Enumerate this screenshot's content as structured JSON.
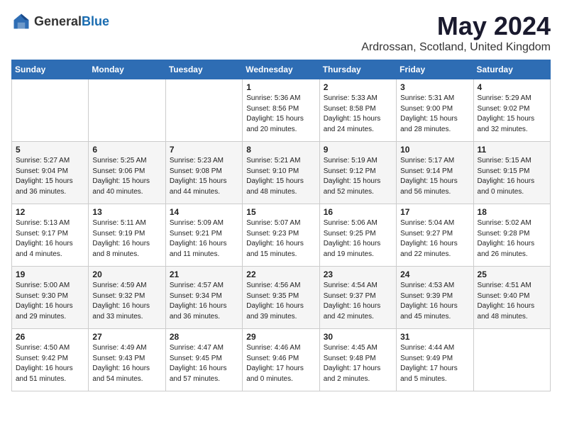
{
  "logo": {
    "text_general": "General",
    "text_blue": "Blue"
  },
  "title": "May 2024",
  "subtitle": "Ardrossan, Scotland, United Kingdom",
  "days_of_week": [
    "Sunday",
    "Monday",
    "Tuesday",
    "Wednesday",
    "Thursday",
    "Friday",
    "Saturday"
  ],
  "weeks": [
    [
      {
        "day": "",
        "sunrise": "",
        "sunset": "",
        "daylight": ""
      },
      {
        "day": "",
        "sunrise": "",
        "sunset": "",
        "daylight": ""
      },
      {
        "day": "",
        "sunrise": "",
        "sunset": "",
        "daylight": ""
      },
      {
        "day": "1",
        "sunrise": "Sunrise: 5:36 AM",
        "sunset": "Sunset: 8:56 PM",
        "daylight": "Daylight: 15 hours and 20 minutes."
      },
      {
        "day": "2",
        "sunrise": "Sunrise: 5:33 AM",
        "sunset": "Sunset: 8:58 PM",
        "daylight": "Daylight: 15 hours and 24 minutes."
      },
      {
        "day": "3",
        "sunrise": "Sunrise: 5:31 AM",
        "sunset": "Sunset: 9:00 PM",
        "daylight": "Daylight: 15 hours and 28 minutes."
      },
      {
        "day": "4",
        "sunrise": "Sunrise: 5:29 AM",
        "sunset": "Sunset: 9:02 PM",
        "daylight": "Daylight: 15 hours and 32 minutes."
      }
    ],
    [
      {
        "day": "5",
        "sunrise": "Sunrise: 5:27 AM",
        "sunset": "Sunset: 9:04 PM",
        "daylight": "Daylight: 15 hours and 36 minutes."
      },
      {
        "day": "6",
        "sunrise": "Sunrise: 5:25 AM",
        "sunset": "Sunset: 9:06 PM",
        "daylight": "Daylight: 15 hours and 40 minutes."
      },
      {
        "day": "7",
        "sunrise": "Sunrise: 5:23 AM",
        "sunset": "Sunset: 9:08 PM",
        "daylight": "Daylight: 15 hours and 44 minutes."
      },
      {
        "day": "8",
        "sunrise": "Sunrise: 5:21 AM",
        "sunset": "Sunset: 9:10 PM",
        "daylight": "Daylight: 15 hours and 48 minutes."
      },
      {
        "day": "9",
        "sunrise": "Sunrise: 5:19 AM",
        "sunset": "Sunset: 9:12 PM",
        "daylight": "Daylight: 15 hours and 52 minutes."
      },
      {
        "day": "10",
        "sunrise": "Sunrise: 5:17 AM",
        "sunset": "Sunset: 9:14 PM",
        "daylight": "Daylight: 15 hours and 56 minutes."
      },
      {
        "day": "11",
        "sunrise": "Sunrise: 5:15 AM",
        "sunset": "Sunset: 9:15 PM",
        "daylight": "Daylight: 16 hours and 0 minutes."
      }
    ],
    [
      {
        "day": "12",
        "sunrise": "Sunrise: 5:13 AM",
        "sunset": "Sunset: 9:17 PM",
        "daylight": "Daylight: 16 hours and 4 minutes."
      },
      {
        "day": "13",
        "sunrise": "Sunrise: 5:11 AM",
        "sunset": "Sunset: 9:19 PM",
        "daylight": "Daylight: 16 hours and 8 minutes."
      },
      {
        "day": "14",
        "sunrise": "Sunrise: 5:09 AM",
        "sunset": "Sunset: 9:21 PM",
        "daylight": "Daylight: 16 hours and 11 minutes."
      },
      {
        "day": "15",
        "sunrise": "Sunrise: 5:07 AM",
        "sunset": "Sunset: 9:23 PM",
        "daylight": "Daylight: 16 hours and 15 minutes."
      },
      {
        "day": "16",
        "sunrise": "Sunrise: 5:06 AM",
        "sunset": "Sunset: 9:25 PM",
        "daylight": "Daylight: 16 hours and 19 minutes."
      },
      {
        "day": "17",
        "sunrise": "Sunrise: 5:04 AM",
        "sunset": "Sunset: 9:27 PM",
        "daylight": "Daylight: 16 hours and 22 minutes."
      },
      {
        "day": "18",
        "sunrise": "Sunrise: 5:02 AM",
        "sunset": "Sunset: 9:28 PM",
        "daylight": "Daylight: 16 hours and 26 minutes."
      }
    ],
    [
      {
        "day": "19",
        "sunrise": "Sunrise: 5:00 AM",
        "sunset": "Sunset: 9:30 PM",
        "daylight": "Daylight: 16 hours and 29 minutes."
      },
      {
        "day": "20",
        "sunrise": "Sunrise: 4:59 AM",
        "sunset": "Sunset: 9:32 PM",
        "daylight": "Daylight: 16 hours and 33 minutes."
      },
      {
        "day": "21",
        "sunrise": "Sunrise: 4:57 AM",
        "sunset": "Sunset: 9:34 PM",
        "daylight": "Daylight: 16 hours and 36 minutes."
      },
      {
        "day": "22",
        "sunrise": "Sunrise: 4:56 AM",
        "sunset": "Sunset: 9:35 PM",
        "daylight": "Daylight: 16 hours and 39 minutes."
      },
      {
        "day": "23",
        "sunrise": "Sunrise: 4:54 AM",
        "sunset": "Sunset: 9:37 PM",
        "daylight": "Daylight: 16 hours and 42 minutes."
      },
      {
        "day": "24",
        "sunrise": "Sunrise: 4:53 AM",
        "sunset": "Sunset: 9:39 PM",
        "daylight": "Daylight: 16 hours and 45 minutes."
      },
      {
        "day": "25",
        "sunrise": "Sunrise: 4:51 AM",
        "sunset": "Sunset: 9:40 PM",
        "daylight": "Daylight: 16 hours and 48 minutes."
      }
    ],
    [
      {
        "day": "26",
        "sunrise": "Sunrise: 4:50 AM",
        "sunset": "Sunset: 9:42 PM",
        "daylight": "Daylight: 16 hours and 51 minutes."
      },
      {
        "day": "27",
        "sunrise": "Sunrise: 4:49 AM",
        "sunset": "Sunset: 9:43 PM",
        "daylight": "Daylight: 16 hours and 54 minutes."
      },
      {
        "day": "28",
        "sunrise": "Sunrise: 4:47 AM",
        "sunset": "Sunset: 9:45 PM",
        "daylight": "Daylight: 16 hours and 57 minutes."
      },
      {
        "day": "29",
        "sunrise": "Sunrise: 4:46 AM",
        "sunset": "Sunset: 9:46 PM",
        "daylight": "Daylight: 17 hours and 0 minutes."
      },
      {
        "day": "30",
        "sunrise": "Sunrise: 4:45 AM",
        "sunset": "Sunset: 9:48 PM",
        "daylight": "Daylight: 17 hours and 2 minutes."
      },
      {
        "day": "31",
        "sunrise": "Sunrise: 4:44 AM",
        "sunset": "Sunset: 9:49 PM",
        "daylight": "Daylight: 17 hours and 5 minutes."
      },
      {
        "day": "",
        "sunrise": "",
        "sunset": "",
        "daylight": ""
      }
    ]
  ]
}
